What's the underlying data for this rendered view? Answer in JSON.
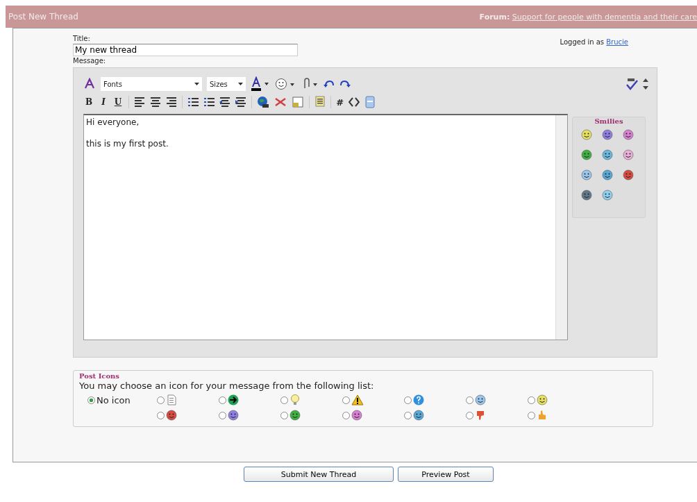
{
  "header": {
    "title": "Post New Thread",
    "forum_label": "Forum:",
    "forum_link": "Support for people with dementia and their care"
  },
  "title_label": "Title:",
  "title_value": "My new thread",
  "logged_in_text": "Logged in as",
  "user_link": "Brucie",
  "message_label": "Message:",
  "editor": {
    "font_select": "Fonts",
    "size_select": "Sizes",
    "format_buttons": [
      "B",
      "I",
      "U"
    ],
    "hash_button": "#",
    "message_lines": [
      "Hi everyone,",
      "this is my first post."
    ],
    "smilies_title": "Smilies",
    "smilies": [
      {
        "color": "#e6e060"
      },
      {
        "color": "#8f7fe0"
      },
      {
        "color": "#d77fd0"
      },
      {
        "color": "#40b040"
      },
      {
        "color": "#6ab8dd"
      },
      {
        "color": "#e8b0d8"
      },
      {
        "color": "#9ac6ee"
      },
      {
        "color": "#58a8d8"
      },
      {
        "color": "#d84b40"
      },
      {
        "color": "#607888"
      },
      {
        "color": "#90d0f0"
      }
    ]
  },
  "post_icons": {
    "legend": "Post Icons",
    "instruction": "You may choose an icon for your message from the following list:",
    "none_label": "No icon",
    "icons": [
      {
        "kind": "none",
        "selected": true
      },
      {
        "kind": "document",
        "selected": false
      },
      {
        "kind": "arrow",
        "selected": false
      },
      {
        "kind": "bulb",
        "selected": false
      },
      {
        "kind": "warning",
        "selected": false
      },
      {
        "kind": "question",
        "selected": false
      },
      {
        "kind": "face",
        "color": "#9ac6ee",
        "selected": false
      },
      {
        "kind": "face",
        "color": "#e6e060",
        "selected": false
      },
      {
        "kind": "face",
        "color": "#d84b40",
        "selected": false
      },
      {
        "kind": "face",
        "color": "#8f7fe0",
        "selected": false
      },
      {
        "kind": "face",
        "color": "#40b040",
        "selected": false
      },
      {
        "kind": "face",
        "color": "#d77fd0",
        "selected": false
      },
      {
        "kind": "face",
        "color": "#58a8d8",
        "selected": false
      },
      {
        "kind": "thumbsdown",
        "selected": false
      },
      {
        "kind": "thumbsup",
        "selected": false
      }
    ]
  },
  "buttons": [
    {
      "label": "Submit New Thread"
    },
    {
      "label": "Preview Post"
    }
  ]
}
